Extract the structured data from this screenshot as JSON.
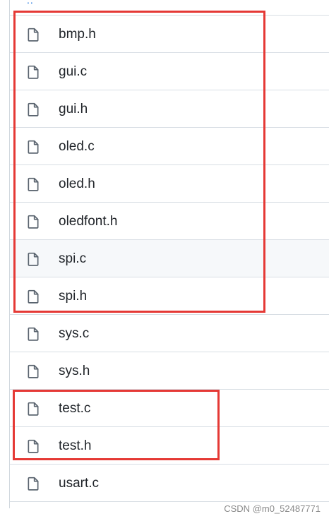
{
  "parent_link": "..",
  "files": [
    {
      "name": "bmp.h",
      "icon": "file-icon"
    },
    {
      "name": "gui.c",
      "icon": "file-icon"
    },
    {
      "name": "gui.h",
      "icon": "file-icon"
    },
    {
      "name": "oled.c",
      "icon": "file-icon"
    },
    {
      "name": "oled.h",
      "icon": "file-icon"
    },
    {
      "name": "oledfont.h",
      "icon": "file-icon"
    },
    {
      "name": "spi.c",
      "icon": "file-icon"
    },
    {
      "name": "spi.h",
      "icon": "file-icon"
    },
    {
      "name": "sys.c",
      "icon": "file-icon"
    },
    {
      "name": "sys.h",
      "icon": "file-icon"
    },
    {
      "name": "test.c",
      "icon": "file-icon"
    },
    {
      "name": "test.h",
      "icon": "file-icon"
    },
    {
      "name": "usart.c",
      "icon": "file-icon"
    }
  ],
  "highlights": [
    {
      "color": "#e53935",
      "covers": [
        "bmp.h",
        "gui.c",
        "gui.h",
        "oled.c",
        "oled.h",
        "oledfont.h",
        "spi.c",
        "spi.h"
      ]
    },
    {
      "color": "#e53935",
      "covers": [
        "test.c",
        "test.h"
      ]
    }
  ],
  "colors": {
    "link": "#0969da",
    "text": "#1f2328",
    "border": "#d8dee4",
    "hover_row": "#f6f8fa"
  },
  "watermark": "CSDN @m0_52487771"
}
